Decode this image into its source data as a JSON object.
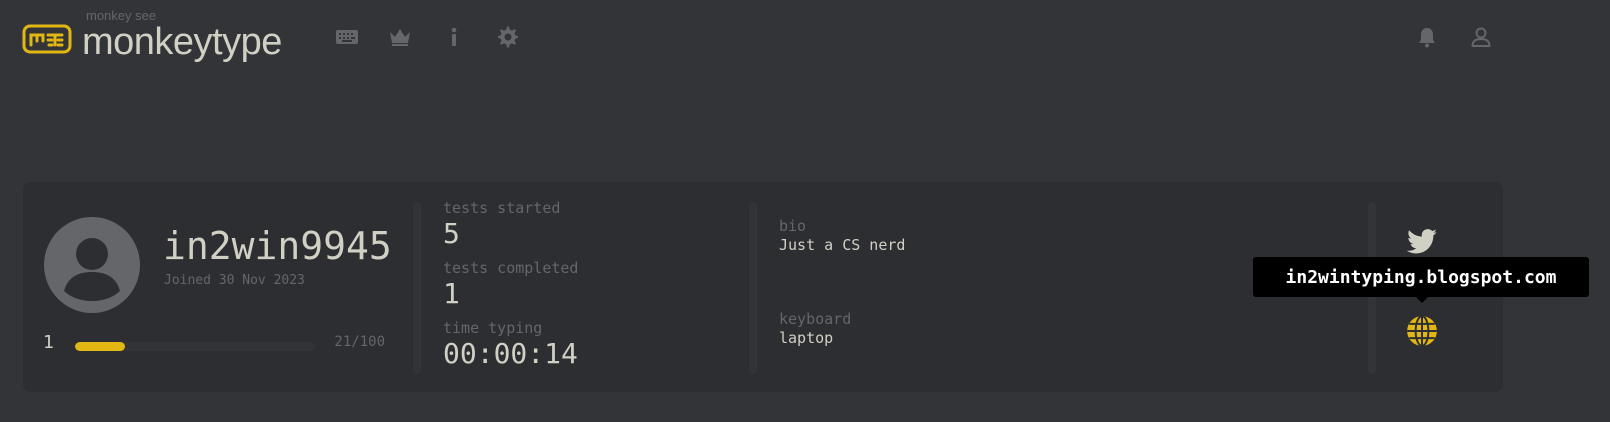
{
  "header": {
    "logo_small": "monkey see",
    "logo_main": "monkeytype",
    "nav_icons": [
      "keyboard-icon",
      "crown-icon",
      "info-icon",
      "settings-icon"
    ],
    "right_icons": [
      "bell-icon",
      "user-icon"
    ]
  },
  "profile": {
    "username": "in2win9945",
    "joined": "Joined 30 Nov 2023",
    "level": "1",
    "xp_text": "21/100",
    "xp_fraction": 0.21
  },
  "stats": {
    "tests_started_label": "tests started",
    "tests_started": "5",
    "tests_completed_label": "tests completed",
    "tests_completed": "1",
    "time_typing_label": "time typing",
    "time_typing": "00:00:14"
  },
  "details": {
    "bio_label": "bio",
    "bio": "Just a CS nerd",
    "keyboard_label": "keyboard",
    "keyboard": "laptop"
  },
  "socials": {
    "icons": [
      "twitter-icon",
      "globe-icon"
    ],
    "tooltip": "in2wintyping.blogspot.com"
  },
  "colors": {
    "background": "#323437",
    "card": "#2c2e31",
    "accent": "#e2b714",
    "text": "#d1d0c5",
    "muted": "#646669"
  }
}
